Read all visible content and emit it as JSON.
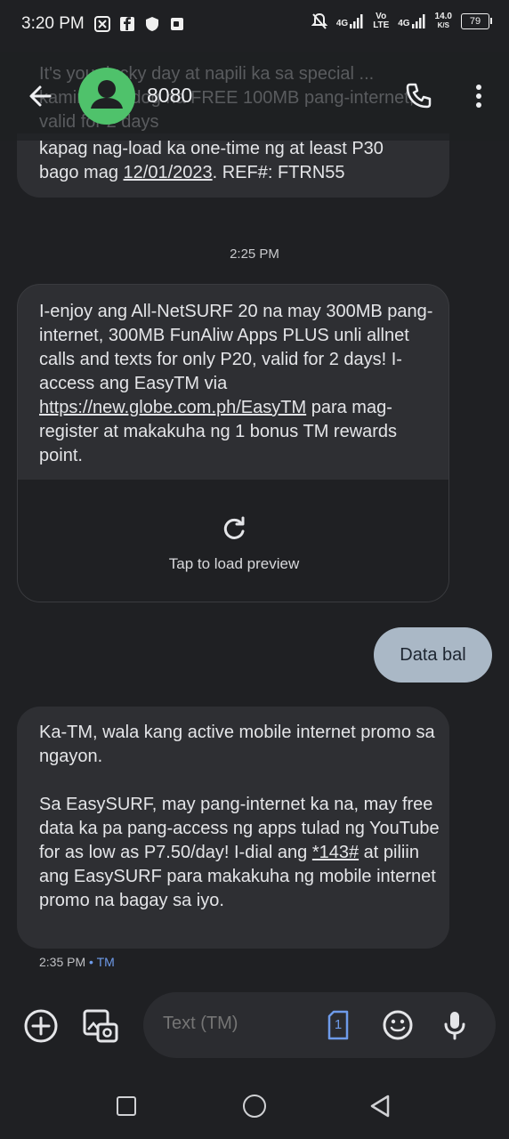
{
  "status_bar": {
    "time": "3:20 PM",
    "signal1_label": "4G",
    "volte_label": "Vo LTE",
    "signal2_label": "4G",
    "speed_value": "14.0",
    "speed_unit": "K/S",
    "battery": "79"
  },
  "header": {
    "contact_name": "8080",
    "ghost_text": "It's your lucky day at napili ka sa special ... kaming handog na FREE 100MB pang-internet, valid for 2 days"
  },
  "messages": {
    "m1_line1": "kapag nag-load ka one-time ng at least P30",
    "m1_prefix": "bago mag ",
    "m1_date": "12/01/2023",
    "m1_suffix": ". REF#: FTRN55",
    "divider_time": "2:25 PM",
    "m2_text_a": "I-enjoy ang All-NetSURF 20 na may 300MB pang-internet, 300MB FunAliw Apps PLUS unli allnet calls and texts for only P20, valid for 2 days! I-access ang EasyTM via ",
    "m2_link": "https://new.globe.com.ph/EasyTM",
    "m2_text_b": " para mag-register at makakuha ng 1 bonus TM rewards point.",
    "m2_preview_label": "Tap to load preview",
    "sent_text": "Data bal",
    "m3_para1": "Ka-TM, wala kang active mobile internet promo sa ngayon.",
    "m3_para2_a": "Sa EasySURF, may pang-internet ka na, may free data ka pa pang-access ng apps tulad ng YouTube for as low as P7.50/day! I-dial ang ",
    "m3_code": "*143#",
    "m3_para2_b": " at piliin ang EasySURF para makakuha ng mobile internet promo na bagay sa iyo.",
    "m3_time": "2:35 PM",
    "m3_sep": " • ",
    "m3_sim": "TM"
  },
  "compose": {
    "placeholder": "Text (TM)",
    "sim_slot": "1"
  },
  "colors": {
    "background": "#1f2023",
    "bubble": "#2e2f33",
    "sent_bubble": "#aab8c6",
    "avatar": "#4fc26b",
    "sim_accent": "#6e9bea"
  }
}
